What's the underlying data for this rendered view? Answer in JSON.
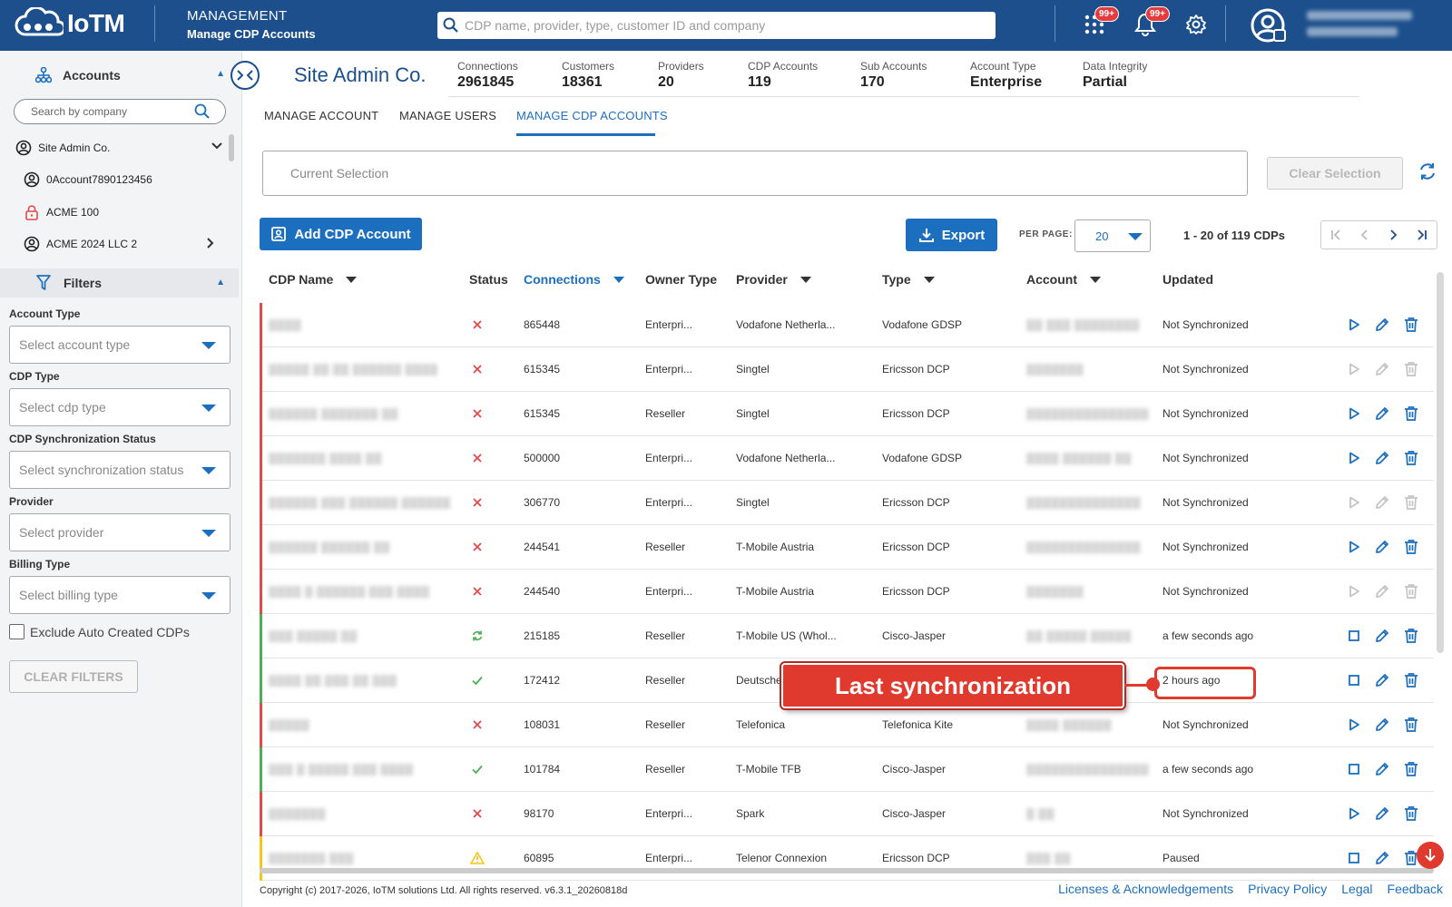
{
  "header": {
    "logo_text": "IoTM",
    "section": "MANAGEMENT",
    "subsection": "Manage CDP Accounts",
    "search_placeholder": "CDP name, provider, type, customer ID and company",
    "apps_badge": "99+",
    "notifications_badge": "99+"
  },
  "sidebar": {
    "accounts_title": "Accounts",
    "search_placeholder": "Search by company",
    "accounts": [
      {
        "label": "Site Admin Co."
      },
      {
        "label": "0Account7890123456"
      },
      {
        "label": "ACME 100"
      },
      {
        "label": "ACME 2024 LLC 2"
      }
    ],
    "filters_title": "Filters",
    "filters": [
      {
        "label": "Account Type",
        "placeholder": "Select account type"
      },
      {
        "label": "CDP Type",
        "placeholder": "Select cdp type"
      },
      {
        "label": "CDP Synchronization Status",
        "placeholder": "Select synchronization status"
      },
      {
        "label": "Provider",
        "placeholder": "Select provider"
      },
      {
        "label": "Billing Type",
        "placeholder": "Select billing type"
      }
    ],
    "exclude_label": "Exclude Auto Created CDPs",
    "clear_filters": "CLEAR FILTERS"
  },
  "account": {
    "name": "Site Admin Co.",
    "stats": [
      {
        "label": "Connections",
        "value": "2961845"
      },
      {
        "label": "Customers",
        "value": "18361"
      },
      {
        "label": "Providers",
        "value": "20"
      },
      {
        "label": "CDP Accounts",
        "value": "119"
      },
      {
        "label": "Sub Accounts",
        "value": "170"
      },
      {
        "label": "Account Type",
        "value": "Enterprise"
      },
      {
        "label": "Data Integrity",
        "value": "Partial"
      }
    ]
  },
  "tabs": [
    {
      "label": "MANAGE ACCOUNT"
    },
    {
      "label": "MANAGE USERS"
    },
    {
      "label": "MANAGE CDP ACCOUNTS"
    }
  ],
  "selection": {
    "current_selection": "Current Selection",
    "clear_selection": "Clear Selection"
  },
  "toolbar": {
    "add_label": "Add CDP Account",
    "export_label": "Export",
    "per_page_label": "PER PAGE:",
    "per_page_value": "20",
    "range": "1 - 20 of 119 CDPs"
  },
  "table": {
    "headers": [
      "CDP Name",
      "Status",
      "Connections",
      "Owner Type",
      "Provider",
      "Type",
      "Account",
      "Updated"
    ],
    "rows": [
      {
        "name": "▒▒▒▒",
        "status": "error",
        "connections": "865448",
        "owner": "Enterpri...",
        "provider": "Vodafone Netherla...",
        "type": "Vodafone GDSP",
        "account": "▒▒ ▒▒▒ ▒▒▒▒▒▒▒▒",
        "updated": "Not Synchronized",
        "bar": "#e04a4a",
        "play": "active",
        "first": "play"
      },
      {
        "name": "▒▒▒▒▒ ▒▒ ▒▒ ▒▒▒▒▒▒ ▒▒▒▒",
        "status": "error",
        "connections": "615345",
        "owner": "Enterpri...",
        "provider": "Singtel",
        "type": "Ericsson DCP",
        "account": "▒▒▒▒▒▒▒",
        "updated": "Not Synchronized",
        "bar": "#e04a4a",
        "play": "disabled",
        "first": "play"
      },
      {
        "name": "▒▒▒▒▒▒ ▒▒▒▒▒▒▒ ▒▒",
        "status": "error",
        "connections": "615345",
        "owner": "Reseller",
        "provider": "Singtel",
        "type": "Ericsson DCP",
        "account": "▒▒▒▒▒▒▒▒▒▒▒▒▒▒▒",
        "updated": "Not Synchronized",
        "bar": "#e04a4a",
        "play": "active",
        "first": "play"
      },
      {
        "name": "▒▒▒▒▒▒▒ ▒▒▒▒ ▒▒",
        "status": "error",
        "connections": "500000",
        "owner": "Enterpri...",
        "provider": "Vodafone Netherla...",
        "type": "Vodafone GDSP",
        "account": "▒▒▒▒ ▒▒▒▒▒▒ ▒▒",
        "updated": "Not Synchronized",
        "bar": "#e04a4a",
        "play": "active",
        "first": "play"
      },
      {
        "name": "▒▒▒▒▒▒ ▒▒▒ ▒▒▒▒▒▒ ▒▒▒▒▒▒",
        "status": "error",
        "connections": "306770",
        "owner": "Enterpri...",
        "provider": "Singtel",
        "type": "Ericsson DCP",
        "account": "▒▒▒▒▒▒▒▒▒▒▒▒▒▒",
        "updated": "Not Synchronized",
        "bar": "#e04a4a",
        "play": "disabled",
        "first": "play"
      },
      {
        "name": "▒▒▒▒▒▒ ▒▒▒▒▒▒ ▒▒",
        "status": "error",
        "connections": "244541",
        "owner": "Reseller",
        "provider": "T-Mobile Austria",
        "type": "Ericsson DCP",
        "account": "▒▒▒▒▒▒▒▒▒▒▒▒▒▒",
        "updated": "Not Synchronized",
        "bar": "#e04a4a",
        "play": "active",
        "first": "play"
      },
      {
        "name": "▒▒▒▒ ▒ ▒▒▒▒▒▒ ▒▒▒ ▒▒▒▒",
        "status": "error",
        "connections": "244540",
        "owner": "Enterpri...",
        "provider": "T-Mobile Austria",
        "type": "Ericsson DCP",
        "account": "▒▒▒▒▒▒▒",
        "updated": "Not Synchronized",
        "bar": "#e04a4a",
        "play": "disabled",
        "first": "play"
      },
      {
        "name": "▒▒▒ ▒▒▒▒▒ ▒▒",
        "status": "syncing",
        "connections": "215185",
        "owner": "Reseller",
        "provider": "T-Mobile US (Whol...",
        "type": "Cisco-Jasper",
        "account": "▒▒ ▒▒▒▒▒ ▒▒▒▒▒",
        "updated": "a few seconds ago",
        "bar": "#4caf50",
        "play": "active",
        "first": "stop"
      },
      {
        "name": "▒▒▒▒ ▒▒ ▒▒▒ ▒▒ ▒▒▒",
        "status": "ok",
        "connections": "172412",
        "owner": "Reseller",
        "provider": "Deutsche",
        "type": "",
        "account": "",
        "updated": "2 hours ago",
        "bar": "#4caf50",
        "play": "active",
        "first": "stop"
      },
      {
        "name": "▒▒▒▒▒",
        "status": "error",
        "connections": "108031",
        "owner": "Reseller",
        "provider": "Telefonica",
        "type": "Telefonica Kite",
        "account": "▒▒▒▒ ▒▒▒▒▒▒",
        "updated": "Not Synchronized",
        "bar": "#e04a4a",
        "play": "active",
        "first": "play"
      },
      {
        "name": "▒▒▒ ▒ ▒▒▒▒▒ ▒▒▒ ▒▒▒▒",
        "status": "ok",
        "connections": "101784",
        "owner": "Reseller",
        "provider": "T-Mobile TFB",
        "type": "Cisco-Jasper",
        "account": "▒▒▒▒▒▒▒▒▒▒▒▒▒▒▒",
        "updated": "a few seconds ago",
        "bar": "#4caf50",
        "play": "active",
        "first": "stop"
      },
      {
        "name": "▒▒▒▒▒▒▒",
        "status": "error",
        "connections": "98170",
        "owner": "Enterpri...",
        "provider": "Spark",
        "type": "Cisco-Jasper",
        "account": "▒ ▒▒",
        "updated": "Not Synchronized",
        "bar": "#e04a4a",
        "play": "active",
        "first": "play"
      },
      {
        "name": "▒▒▒▒▒▒▒ ▒▒▒",
        "status": "warning",
        "connections": "60895",
        "owner": "Enterpri...",
        "provider": "Telenor Connexion",
        "type": "Ericsson DCP",
        "account": "▒▒▒ ▒▒",
        "updated": "Paused",
        "bar": "#f5c518",
        "play": "active",
        "first": "stop"
      }
    ]
  },
  "callout": {
    "text": "Last synchronization"
  },
  "footer": {
    "copyright": "Copyright (c) 2017-2026, IoTM solutions Ltd. All rights reserved. v6.3.1_20260818d",
    "links": [
      "Licenses & Acknowledgements",
      "Privacy Policy",
      "Legal",
      "Feedback"
    ]
  },
  "colors": {
    "header_bg": "#1c4f8c",
    "accent": "#1c6fbf",
    "error": "#e04a4a",
    "ok": "#4caf50",
    "warning": "#f5c518",
    "callout": "#e03a2e"
  }
}
